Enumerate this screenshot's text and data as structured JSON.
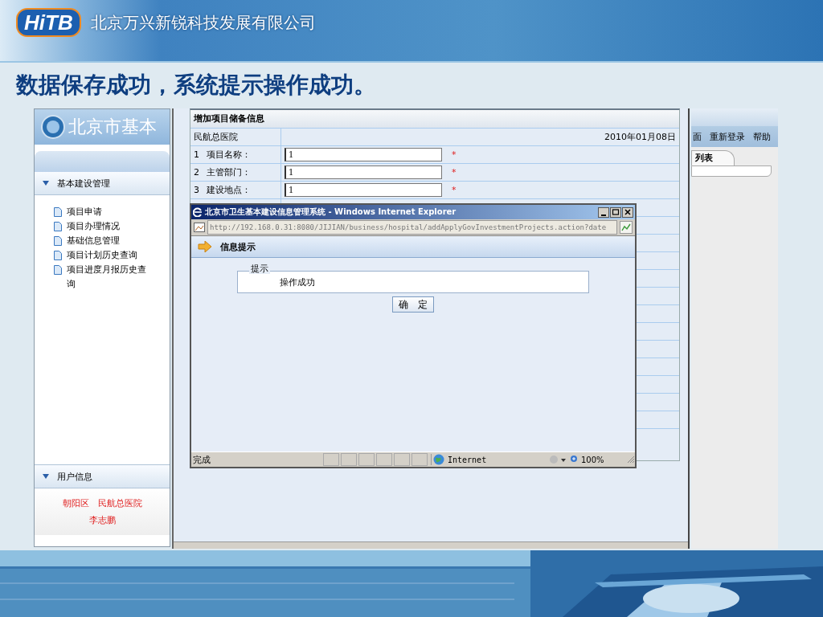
{
  "slide": {
    "logo": "HiTB",
    "company": "北京万兴新锐科技发展有限公司",
    "title": "数据保存成功，系统提示操作成功。"
  },
  "sidebar": {
    "logo_text": "北京市基本",
    "sections": [
      {
        "title": "基本建设管理",
        "expanded": true,
        "items": [
          "项目申请",
          "项目办理情况",
          "基础信息管理",
          "项目计划历史查询",
          "项目进度月报历史查询"
        ]
      },
      {
        "title": "用户信息",
        "expanded": true
      }
    ],
    "user": {
      "district": "朝阳区",
      "hospital": "民航总医院",
      "name": "李志鹏"
    }
  },
  "right_window": {
    "menu": [
      "面",
      "重新登录",
      "帮助"
    ],
    "tabs": [
      "列表"
    ]
  },
  "form": {
    "title": "增加项目储备信息",
    "org": "民航总医院",
    "date": "2010年01月08日",
    "required_mark": "*",
    "fields": [
      {
        "number": "1",
        "label": "项目名称：",
        "value": "1",
        "required": true
      },
      {
        "number": "2",
        "label": "主管部门：",
        "value": "1",
        "required": true
      },
      {
        "number": "3",
        "label": "建设地点：",
        "value": "1",
        "required": true
      }
    ]
  },
  "popup": {
    "title": "北京市卫生基本建设信息管理系统 - Windows Internet Explorer",
    "url": "http://192.168.0.31:8080/JIJIAN/business/hospital/addApplyGovInvestmentProjects.action?date",
    "header": "信息提示",
    "legend": "提示",
    "message": "操作成功",
    "ok_button": "确　定",
    "status": "完成",
    "zone": "Internet",
    "zoom": "100%"
  }
}
